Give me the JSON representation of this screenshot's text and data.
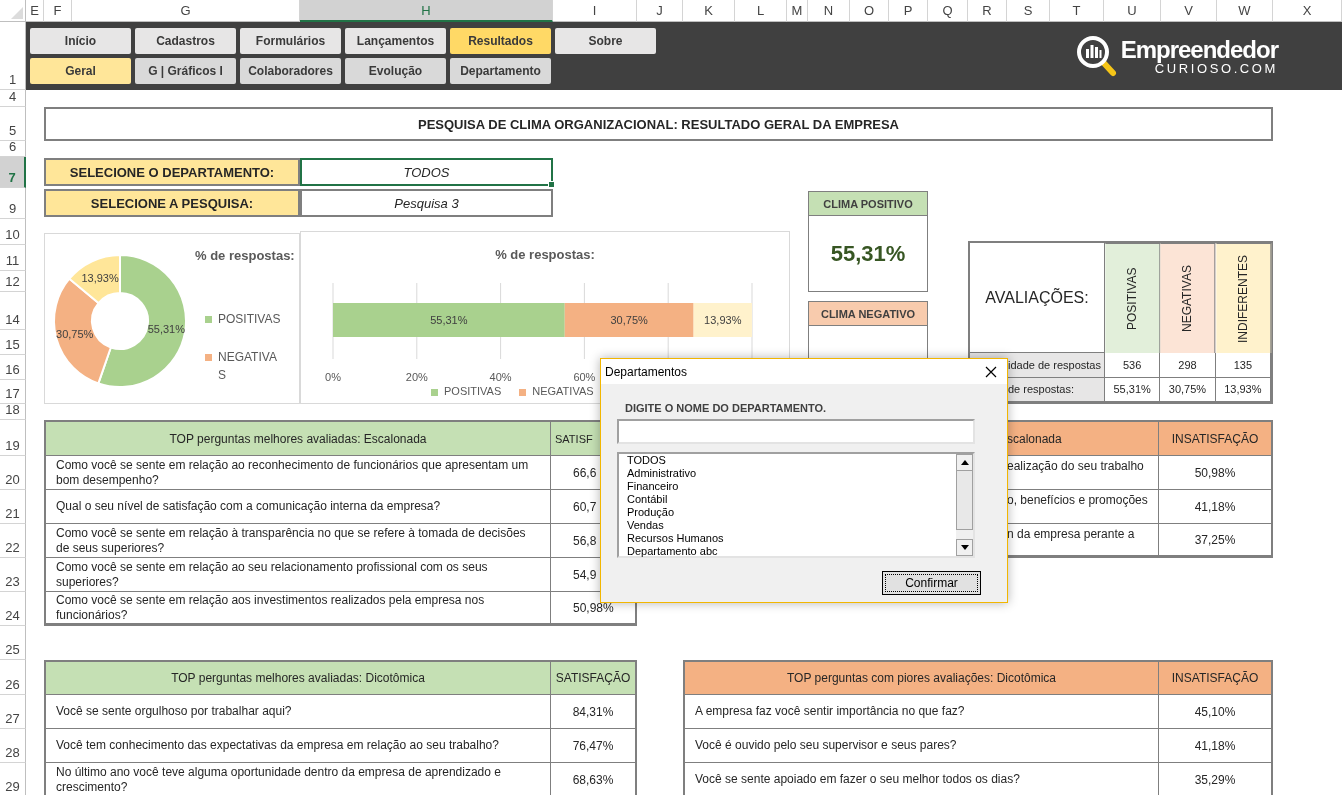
{
  "spreadsheet": {
    "columns": [
      {
        "label": "E",
        "selected": false
      },
      {
        "label": "F",
        "selected": false
      },
      {
        "label": "G",
        "selected": false
      },
      {
        "label": "H",
        "selected": true
      },
      {
        "label": "I",
        "selected": false
      },
      {
        "label": "J",
        "selected": false
      },
      {
        "label": "K",
        "selected": false
      },
      {
        "label": "L",
        "selected": false
      },
      {
        "label": "M",
        "selected": false
      },
      {
        "label": "N",
        "selected": false
      },
      {
        "label": "O",
        "selected": false
      },
      {
        "label": "P",
        "selected": false
      },
      {
        "label": "Q",
        "selected": false
      },
      {
        "label": "R",
        "selected": false
      },
      {
        "label": "S",
        "selected": false
      },
      {
        "label": "T",
        "selected": false
      },
      {
        "label": "U",
        "selected": false
      },
      {
        "label": "V",
        "selected": false
      },
      {
        "label": "W",
        "selected": false
      },
      {
        "label": "X",
        "selected": false
      }
    ],
    "rows": [
      {
        "label": "1",
        "selected": false
      },
      {
        "label": "4",
        "selected": false
      },
      {
        "label": "5",
        "selected": false
      },
      {
        "label": "6",
        "selected": false
      },
      {
        "label": "7",
        "selected": true
      },
      {
        "label": "9",
        "selected": false
      },
      {
        "label": "10",
        "selected": false
      },
      {
        "label": "11",
        "selected": false
      },
      {
        "label": "12",
        "selected": false
      },
      {
        "label": "14",
        "selected": false
      },
      {
        "label": "15",
        "selected": false
      },
      {
        "label": "16",
        "selected": false
      },
      {
        "label": "17",
        "selected": false
      },
      {
        "label": "18",
        "selected": false
      },
      {
        "label": "19",
        "selected": false
      },
      {
        "label": "20",
        "selected": false
      },
      {
        "label": "21",
        "selected": false
      },
      {
        "label": "22",
        "selected": false
      },
      {
        "label": "23",
        "selected": false
      },
      {
        "label": "24",
        "selected": false
      },
      {
        "label": "25",
        "selected": false
      },
      {
        "label": "26",
        "selected": false
      },
      {
        "label": "27",
        "selected": false
      },
      {
        "label": "28",
        "selected": false
      },
      {
        "label": "29",
        "selected": false
      }
    ]
  },
  "nav": {
    "main": [
      {
        "label": "Início",
        "selected": false
      },
      {
        "label": "Cadastros",
        "selected": false
      },
      {
        "label": "Formulários",
        "selected": false
      },
      {
        "label": "Lançamentos",
        "selected": false
      },
      {
        "label": "Resultados",
        "selected": true
      },
      {
        "label": "Sobre",
        "selected": false
      }
    ],
    "sub": [
      {
        "label": "Geral",
        "selected": true
      },
      {
        "label": "G | Gráficos I",
        "selected": false
      },
      {
        "label": "Colaboradores",
        "selected": false
      },
      {
        "label": "Evolução",
        "selected": false
      },
      {
        "label": "Departamento",
        "selected": false
      }
    ]
  },
  "logo": {
    "name": "Empreendedor",
    "domain": "CURIOSO.COM"
  },
  "title": "PESQUISA DE CLIMA ORGANIZACIONAL: RESULTADO GERAL DA EMPRESA",
  "selectors": [
    {
      "label": "SELECIONE O DEPARTAMENTO:",
      "value": "TODOS",
      "selected": true
    },
    {
      "label": "SELECIONE A PESQUISA:",
      "value": "Pesquisa 3",
      "selected": false
    }
  ],
  "donut_chart": {
    "chart_data": {
      "type": "donut",
      "title": "% de respostas:",
      "value_labels": [
        "55,31%",
        "30,75%",
        "13,93%"
      ],
      "categories": [
        "POSITIVAS",
        "NEGATIVAS",
        null
      ],
      "values": [
        55.31,
        30.75,
        13.93
      ],
      "colors": [
        "#a9d18e",
        "#f4b183",
        "#ffe699"
      ],
      "legend": true
    }
  },
  "bar_chart": {
    "chart_data": {
      "type": "bar",
      "orientation": "horizontal",
      "stacked": true,
      "grid": true,
      "legend": true,
      "title": "% de respostas:",
      "xlim": [
        0,
        100
      ],
      "xticks": [
        {
          "value": 0,
          "label": "0%"
        },
        {
          "value": 20,
          "label": "20%"
        },
        {
          "value": 40,
          "label": "40%"
        },
        {
          "value": 60,
          "label": "60%"
        }
      ],
      "value_labels": [
        "55,31%",
        "30,75%",
        "13,93%"
      ],
      "series": [
        {
          "name": "POSITIVAS",
          "color": "#a9d18e",
          "values": [
            55.31
          ]
        },
        {
          "name": "NEGATIVAS",
          "color": "#f4b183",
          "values": [
            30.75
          ]
        },
        {
          "color": "#fff2cc",
          "values": [
            13.93
          ]
        }
      ]
    }
  },
  "climate_cards": [
    {
      "title": "CLIMA POSITIVO",
      "value": "55,31%",
      "color": "#c5e0b4"
    },
    {
      "title": "CLIMA NEGATIVO",
      "color": "#f8cbad"
    }
  ],
  "evaluations": {
    "title": "AVALIAÇÕES:",
    "columns": [
      {
        "label": "POSITIVAS",
        "color": "#e2efda"
      },
      {
        "label": "NEGATIVAS",
        "color": "#fce4d6"
      },
      {
        "label": "INDIFERENTES",
        "color": "#fff2cc"
      }
    ],
    "rows": [
      {
        "label": "idade de respostas",
        "values": [
          "536",
          "298",
          "135"
        ]
      },
      {
        "label": "de respostas:",
        "values": [
          "55,31%",
          "30,75%",
          "13,93%"
        ]
      }
    ]
  },
  "tables": [
    {
      "title": "TOP perguntas melhores avaliadas: Escalonada",
      "metric": "SATISF",
      "color": "#c5e0b4",
      "rows": [
        {
          "question": "Como você se sente em relação ao reconhecimento de funcionários que apresentam um bom desempenho?",
          "value": "66,6"
        },
        {
          "question": "Qual o seu nível de satisfação com a comunicação interna da empresa?",
          "value": "60,7"
        },
        {
          "question": "Como você se sente em relação à transparência no que se refere à tomada de decisões de seus superiores?",
          "value": "56,8"
        },
        {
          "question": "Como você se sente em relação ao seu relacionamento profissional com os seus superiores?",
          "value": "54,9"
        },
        {
          "question": "Como você se sente em relação aos investimentos realizados pela empresa nos funcionários?",
          "value": "50,98%"
        }
      ]
    },
    {
      "title": "scalonada",
      "metric": "INSATISFAÇÃO",
      "color": "#f4b183",
      "rows": [
        {
          "question": "ealização do seu trabalho",
          "value": "50,98%"
        },
        {
          "question": "o, benefícios e promoções",
          "value": "41,18%"
        },
        {
          "question": "n da empresa perante a",
          "value": "37,25%"
        }
      ]
    },
    {
      "title": "TOP perguntas melhores avaliadas: Dicotômica",
      "metric": "SATISFAÇÃO",
      "color": "#c5e0b4",
      "rows": [
        {
          "question": "Você se sente orgulhoso por trabalhar aqui?",
          "value": "84,31%"
        },
        {
          "question": "Você tem conhecimento das expectativas da empresa em relação ao seu trabalho?",
          "value": "76,47%"
        },
        {
          "question": "No último ano você teve alguma oportunidade dentro da empresa de aprendizado e crescimento?",
          "value": "68,63%"
        }
      ]
    },
    {
      "title": "TOP perguntas com piores avaliações: Dicotômica",
      "metric": "INSATISFAÇÃO",
      "color": "#f4b183",
      "rows": [
        {
          "question": "A empresa faz você sentir importância no que faz?",
          "value": "45,10%"
        },
        {
          "question": "Você é ouvido pelo seu supervisor e seus pares?",
          "value": "41,18%"
        },
        {
          "question": "Você se sente apoiado em fazer o seu melhor todos os dias?",
          "value": "35,29%"
        }
      ]
    }
  ],
  "dialog": {
    "title": "Departamentos",
    "label": "DIGITE O NOME DO DEPARTAMENTO.",
    "items": [
      "TODOS",
      "Administrativo",
      "Financeiro",
      "Contábil",
      "Produção",
      "Vendas",
      "Recursos Humanos",
      "Departamento abc"
    ],
    "button": "Confirmar"
  }
}
